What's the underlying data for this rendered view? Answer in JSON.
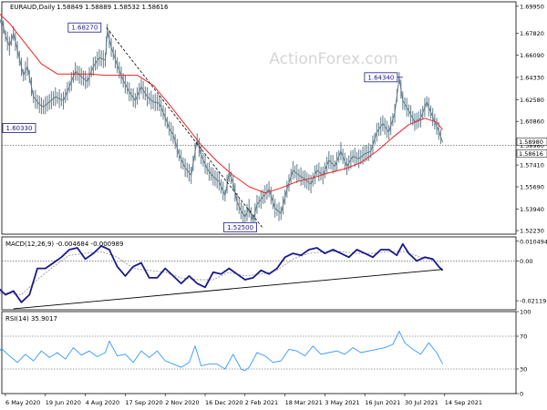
{
  "chart_data": {
    "type": "line",
    "title": "EURAUD,Daily",
    "header_values": "1.58849 1.58889 1.58532 1.58616",
    "watermark": "ActionForex.com",
    "colors": {
      "price": "#607d8b",
      "sma": "#ee2222",
      "macd": "#1a1a8c",
      "signal": "#999999",
      "rsi": "#3399ff",
      "trendline": "#000000",
      "label_border": "#1a1a8c"
    },
    "x_axis": {
      "tick_labels": [
        "6 May 2020",
        "19 Jun 2020",
        "4 Aug 2020",
        "17 Sep 2020",
        "2 Nov 2020",
        "16 Dec 2020",
        "2 Feb 2021",
        "18 Mar 2021",
        "3 May 2021",
        "16 Jun 2021",
        "30 Jul 2021",
        "14 Sep 2021"
      ],
      "tick_positions": [
        0,
        1,
        2,
        3,
        4,
        5,
        6,
        7,
        8,
        9,
        10,
        11
      ]
    },
    "price_panel": {
      "y_ticks": [
        "1.69950",
        "1.67820",
        "1.66090",
        "1.64330",
        "1.62580",
        "1.60860",
        "1.58980",
        "1.57410",
        "1.55690",
        "1.53940",
        "1.52230"
      ],
      "y_tick_values": [
        1.6995,
        1.6782,
        1.6609,
        1.6433,
        1.6258,
        1.6086,
        1.5898,
        1.5741,
        1.5569,
        1.5394,
        1.5223
      ],
      "ylim": [
        1.5195,
        1.703
      ],
      "current_price": "1.58616",
      "current_price_value": 1.58616,
      "dotted_level": "1.58980",
      "dotted_level_value": 1.5898,
      "annotations": [
        {
          "label": "1.68270",
          "value": 1.6827,
          "x": 2.53
        },
        {
          "label": "1.64340",
          "value": 1.6434,
          "x": 9.86
        },
        {
          "label": "1.52500",
          "value": 1.525,
          "x": 6.2
        },
        {
          "label": "1.60330",
          "value": 1.6033,
          "x": -0.1
        }
      ],
      "close_series": [
        [
          -0.3,
          1.672
        ],
        [
          -0.1,
          1.69
        ],
        [
          0,
          1.676
        ],
        [
          0.1,
          1.668
        ],
        [
          0.2,
          1.678
        ],
        [
          0.3,
          1.665
        ],
        [
          0.45,
          1.645
        ],
        [
          0.55,
          1.652
        ],
        [
          0.7,
          1.628
        ],
        [
          0.85,
          1.622
        ],
        [
          0.95,
          1.62
        ],
        [
          1.1,
          1.624
        ],
        [
          1.25,
          1.628
        ],
        [
          1.45,
          1.625
        ],
        [
          1.6,
          1.636
        ],
        [
          1.75,
          1.648
        ],
        [
          1.9,
          1.644
        ],
        [
          2.05,
          1.64
        ],
        [
          2.2,
          1.652
        ],
        [
          2.35,
          1.659
        ],
        [
          2.5,
          1.657
        ],
        [
          2.55,
          1.68
        ],
        [
          2.65,
          1.667
        ],
        [
          2.8,
          1.653
        ],
        [
          2.95,
          1.641
        ],
        [
          3.1,
          1.632
        ],
        [
          3.25,
          1.625
        ],
        [
          3.4,
          1.636
        ],
        [
          3.55,
          1.628
        ],
        [
          3.7,
          1.624
        ],
        [
          3.85,
          1.623
        ],
        [
          4.0,
          1.612
        ],
        [
          4.1,
          1.603
        ],
        [
          4.2,
          1.598
        ],
        [
          4.35,
          1.582
        ],
        [
          4.5,
          1.572
        ],
        [
          4.65,
          1.566
        ],
        [
          4.8,
          1.594
        ],
        [
          4.9,
          1.582
        ],
        [
          5.05,
          1.571
        ],
        [
          5.2,
          1.565
        ],
        [
          5.35,
          1.561
        ],
        [
          5.5,
          1.55
        ],
        [
          5.6,
          1.568
        ],
        [
          5.7,
          1.56
        ],
        [
          5.8,
          1.545
        ],
        [
          5.9,
          1.538
        ],
        [
          6.0,
          1.533
        ],
        [
          6.1,
          1.54
        ],
        [
          6.2,
          1.53
        ],
        [
          6.3,
          1.543
        ],
        [
          6.45,
          1.549
        ],
        [
          6.6,
          1.555
        ],
        [
          6.75,
          1.54
        ],
        [
          6.9,
          1.536
        ],
        [
          7.05,
          1.555
        ],
        [
          7.2,
          1.57
        ],
        [
          7.35,
          1.566
        ],
        [
          7.5,
          1.563
        ],
        [
          7.65,
          1.559
        ],
        [
          7.8,
          1.57
        ],
        [
          7.95,
          1.566
        ],
        [
          8.1,
          1.578
        ],
        [
          8.25,
          1.573
        ],
        [
          8.4,
          1.585
        ],
        [
          8.55,
          1.573
        ],
        [
          8.7,
          1.581
        ],
        [
          8.85,
          1.579
        ],
        [
          9.0,
          1.583
        ],
        [
          9.15,
          1.585
        ],
        [
          9.3,
          1.6
        ],
        [
          9.45,
          1.607
        ],
        [
          9.6,
          1.6
        ],
        [
          9.75,
          1.615
        ],
        [
          9.86,
          1.643
        ],
        [
          9.95,
          1.625
        ],
        [
          10.1,
          1.617
        ],
        [
          10.25,
          1.608
        ],
        [
          10.4,
          1.611
        ],
        [
          10.55,
          1.624
        ],
        [
          10.7,
          1.612
        ],
        [
          10.85,
          1.601
        ],
        [
          10.95,
          1.592
        ]
      ],
      "sma_series": [
        [
          -0.3,
          1.698
        ],
        [
          0.1,
          1.686
        ],
        [
          0.5,
          1.67
        ],
        [
          0.9,
          1.654
        ],
        [
          1.3,
          1.646
        ],
        [
          1.7,
          1.646
        ],
        [
          2.1,
          1.646
        ],
        [
          2.5,
          1.645
        ],
        [
          2.9,
          1.645
        ],
        [
          3.3,
          1.645
        ],
        [
          3.7,
          1.637
        ],
        [
          4.1,
          1.622
        ],
        [
          4.5,
          1.606
        ],
        [
          4.9,
          1.59
        ],
        [
          5.3,
          1.577
        ],
        [
          5.7,
          1.566
        ],
        [
          6.1,
          1.557
        ],
        [
          6.5,
          1.552
        ],
        [
          6.9,
          1.556
        ],
        [
          7.3,
          1.561
        ],
        [
          7.7,
          1.564
        ],
        [
          8.1,
          1.568
        ],
        [
          8.5,
          1.571
        ],
        [
          8.9,
          1.576
        ],
        [
          9.3,
          1.585
        ],
        [
          9.7,
          1.596
        ],
        [
          10.1,
          1.606
        ],
        [
          10.5,
          1.611
        ],
        [
          10.8,
          1.608
        ],
        [
          10.95,
          1.602
        ]
      ]
    },
    "macd_panel": {
      "label": "MACD(12,26,9) -0.004684 -0.000989",
      "y_ticks": [
        "0.010494",
        "0.00",
        "-0.02119"
      ],
      "y_tick_values": [
        0.010494,
        0.0,
        -0.02119
      ],
      "ylim": [
        -0.026,
        0.0128
      ],
      "macd_series": [
        [
          -0.3,
          -0.02
        ],
        [
          -0.15,
          -0.015
        ],
        [
          0,
          -0.018
        ],
        [
          0.2,
          -0.016
        ],
        [
          0.4,
          -0.022
        ],
        [
          0.6,
          -0.018
        ],
        [
          0.8,
          -0.004
        ],
        [
          1.0,
          -0.004
        ],
        [
          1.2,
          -0.001
        ],
        [
          1.4,
          0.002
        ],
        [
          1.6,
          0.006
        ],
        [
          1.8,
          0.007
        ],
        [
          2.0,
          0.001
        ],
        [
          2.2,
          0.004
        ],
        [
          2.4,
          0.008
        ],
        [
          2.6,
          0.006
        ],
        [
          2.8,
          -0.003
        ],
        [
          3.0,
          -0.008
        ],
        [
          3.2,
          -0.003
        ],
        [
          3.4,
          -0.001
        ],
        [
          3.6,
          -0.009
        ],
        [
          3.8,
          -0.009
        ],
        [
          4.0,
          -0.004
        ],
        [
          4.2,
          -0.008
        ],
        [
          4.4,
          -0.012
        ],
        [
          4.6,
          -0.008
        ],
        [
          4.8,
          -0.012
        ],
        [
          5.0,
          -0.014
        ],
        [
          5.2,
          -0.006
        ],
        [
          5.4,
          -0.007
        ],
        [
          5.6,
          -0.004
        ],
        [
          5.8,
          -0.007
        ],
        [
          6.0,
          -0.01
        ],
        [
          6.2,
          -0.009
        ],
        [
          6.4,
          -0.005
        ],
        [
          6.6,
          -0.007
        ],
        [
          6.8,
          -0.004
        ],
        [
          7.0,
          0.002
        ],
        [
          7.2,
          0.004
        ],
        [
          7.4,
          0.003
        ],
        [
          7.6,
          0.006
        ],
        [
          7.8,
          0.007
        ],
        [
          8.0,
          0.004
        ],
        [
          8.2,
          0.006
        ],
        [
          8.4,
          0.004
        ],
        [
          8.6,
          0.002
        ],
        [
          8.8,
          0.006
        ],
        [
          9.0,
          0.004
        ],
        [
          9.2,
          0.002
        ],
        [
          9.4,
          0.006
        ],
        [
          9.6,
          0.006
        ],
        [
          9.8,
          0.003
        ],
        [
          9.95,
          0.009
        ],
        [
          10.1,
          0.004
        ],
        [
          10.3,
          0.0
        ],
        [
          10.5,
          0.002
        ],
        [
          10.7,
          0.001
        ],
        [
          10.85,
          -0.003
        ],
        [
          10.95,
          -0.005
        ]
      ],
      "signal_series": [
        [
          -0.3,
          -0.017
        ],
        [
          0,
          -0.017
        ],
        [
          0.4,
          -0.018
        ],
        [
          0.8,
          -0.01
        ],
        [
          1.2,
          -0.003
        ],
        [
          1.6,
          0.003
        ],
        [
          2.0,
          0.004
        ],
        [
          2.4,
          0.005
        ],
        [
          2.8,
          0.002
        ],
        [
          3.2,
          -0.004
        ],
        [
          3.6,
          -0.005
        ],
        [
          4.0,
          -0.006
        ],
        [
          4.4,
          -0.009
        ],
        [
          4.8,
          -0.01
        ],
        [
          5.2,
          -0.01
        ],
        [
          5.6,
          -0.006
        ],
        [
          6.0,
          -0.008
        ],
        [
          6.4,
          -0.007
        ],
        [
          6.8,
          -0.005
        ],
        [
          7.2,
          0.001
        ],
        [
          7.6,
          0.004
        ],
        [
          8.0,
          0.005
        ],
        [
          8.4,
          0.005
        ],
        [
          8.8,
          0.004
        ],
        [
          9.2,
          0.004
        ],
        [
          9.6,
          0.005
        ],
        [
          10.0,
          0.005
        ],
        [
          10.4,
          0.002
        ],
        [
          10.8,
          0.0
        ],
        [
          10.95,
          -0.001
        ]
      ],
      "trendline": [
        [
          0.2,
          -0.0255
        ],
        [
          10.95,
          -0.0045
        ]
      ]
    },
    "rsi_panel": {
      "label": "RSI(14) 35.9017",
      "y_ticks": [
        "100",
        "70",
        "30",
        "0"
      ],
      "y_tick_values": [
        100,
        70,
        30,
        0
      ],
      "ylim": [
        0,
        100
      ],
      "levels": [
        70,
        30
      ],
      "rsi_series": [
        [
          -0.3,
          42
        ],
        [
          -0.1,
          55
        ],
        [
          0.1,
          46
        ],
        [
          0.3,
          38
        ],
        [
          0.5,
          48
        ],
        [
          0.7,
          40
        ],
        [
          0.9,
          52
        ],
        [
          1.1,
          44
        ],
        [
          1.3,
          50
        ],
        [
          1.5,
          42
        ],
        [
          1.7,
          56
        ],
        [
          1.9,
          47
        ],
        [
          2.1,
          52
        ],
        [
          2.3,
          45
        ],
        [
          2.5,
          50
        ],
        [
          2.6,
          64
        ],
        [
          2.8,
          46
        ],
        [
          3.0,
          48
        ],
        [
          3.2,
          38
        ],
        [
          3.4,
          52
        ],
        [
          3.6,
          44
        ],
        [
          3.8,
          52
        ],
        [
          4.0,
          40
        ],
        [
          4.2,
          36
        ],
        [
          4.4,
          32
        ],
        [
          4.6,
          38
        ],
        [
          4.75,
          58
        ],
        [
          4.9,
          34
        ],
        [
          5.1,
          36
        ],
        [
          5.3,
          36
        ],
        [
          5.5,
          30
        ],
        [
          5.7,
          48
        ],
        [
          5.9,
          30
        ],
        [
          6.0,
          28
        ],
        [
          6.1,
          32
        ],
        [
          6.3,
          50
        ],
        [
          6.5,
          46
        ],
        [
          6.7,
          38
        ],
        [
          6.9,
          40
        ],
        [
          7.1,
          54
        ],
        [
          7.3,
          52
        ],
        [
          7.5,
          46
        ],
        [
          7.7,
          58
        ],
        [
          7.9,
          48
        ],
        [
          8.1,
          50
        ],
        [
          8.3,
          52
        ],
        [
          8.5,
          48
        ],
        [
          8.7,
          56
        ],
        [
          8.9,
          50
        ],
        [
          9.1,
          52
        ],
        [
          9.3,
          54
        ],
        [
          9.5,
          56
        ],
        [
          9.7,
          60
        ],
        [
          9.86,
          76
        ],
        [
          10.0,
          62
        ],
        [
          10.2,
          54
        ],
        [
          10.4,
          48
        ],
        [
          10.6,
          62
        ],
        [
          10.8,
          50
        ],
        [
          10.95,
          36
        ]
      ]
    }
  }
}
